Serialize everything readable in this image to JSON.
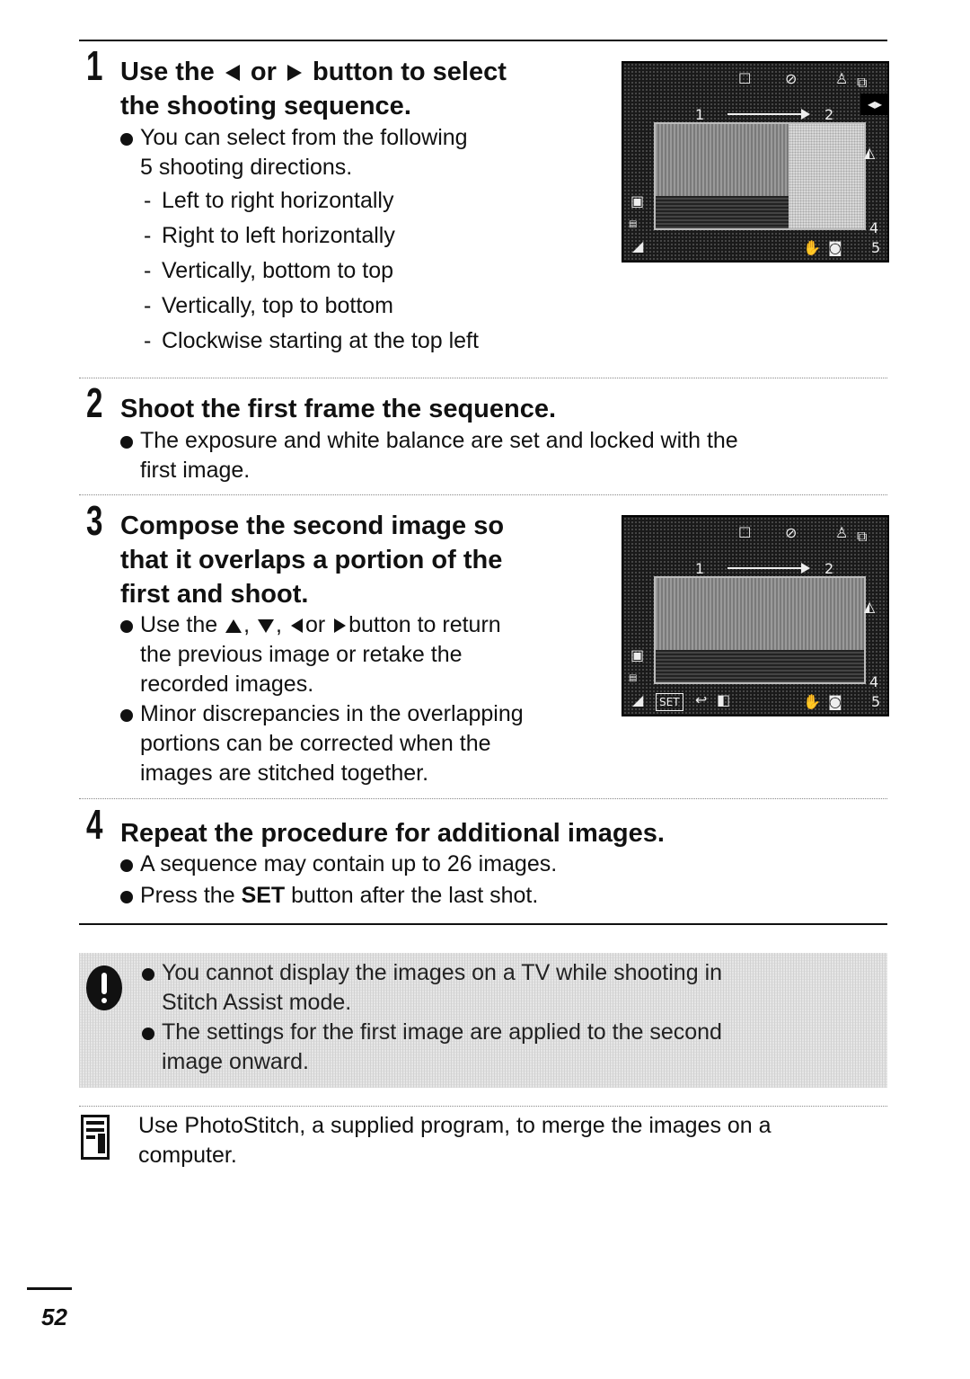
{
  "page_number": "52",
  "steps": [
    {
      "number": "1",
      "title_parts": [
        "Use the",
        "or",
        "button to select",
        "the shooting sequence."
      ],
      "intro": "You can select from the following 5 shooting directions.",
      "intro_line1": "You can select from the following",
      "intro_line2": "5 shooting directions.",
      "options": [
        "Left to right horizontally",
        "Right to left horizontally",
        "Vertically, bottom to top",
        "Vertically, top to bottom",
        "Clockwise starting at the top left"
      ]
    },
    {
      "number": "2",
      "title": "Shoot the first frame the sequence.",
      "bullets": [
        {
          "line1": "The exposure and white balance are set and locked with the",
          "line2": "first image."
        }
      ]
    },
    {
      "number": "3",
      "title_lines": [
        "Compose the second image so",
        "that it overlaps a portion of the",
        "first and shoot."
      ],
      "bullet1_parts": [
        "Use the",
        ",",
        ",",
        "or",
        "button to return"
      ],
      "bullet1_lines": [
        "the previous image or retake the",
        "recorded images."
      ],
      "bullet2_lines": [
        "Minor discrepancies in the overlapping",
        "portions can be corrected when the",
        "images are stitched together."
      ]
    },
    {
      "number": "4",
      "title": "Repeat the procedure for additional images.",
      "bullet1": "A sequence may contain up to 26 images.",
      "bullet2_pre": "Press the",
      "bullet2_bold": "SET",
      "bullet2_post": "button after the last shot."
    }
  ],
  "screens": {
    "seq_from": "1",
    "seq_to": "2",
    "side_value_top": "4",
    "side_value_bottom": "5",
    "set_label": "SET"
  },
  "caution": {
    "icon": "caution-icon",
    "bullets": [
      {
        "line1": "You cannot display the images on a TV while shooting in",
        "line2": "Stitch Assist mode."
      },
      {
        "line1": "The settings for the first image are applied to the second",
        "line2": "image onward."
      }
    ]
  },
  "memo": {
    "icon": "memo-pencil-icon",
    "line1": "Use PhotoStitch, a supplied program, to merge the images on a",
    "line2": "computer."
  }
}
